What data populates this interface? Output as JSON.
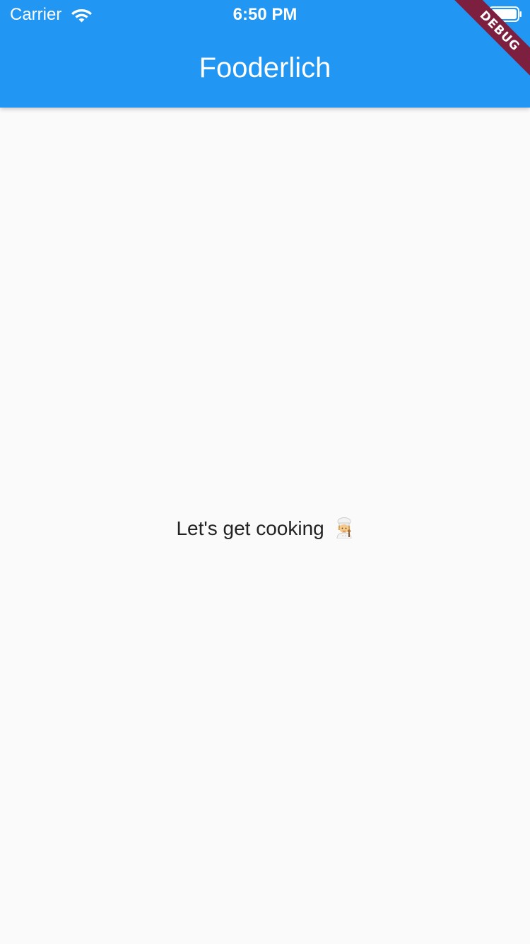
{
  "status_bar": {
    "carrier": "Carrier",
    "time": "6:50 PM",
    "wifi_icon": "wifi-icon",
    "battery_icon": "battery-icon"
  },
  "app_bar": {
    "title": "Fooderlich",
    "color": "#2196f3"
  },
  "debug_banner": {
    "label": "DEBUG",
    "color": "#7d1f3e"
  },
  "body": {
    "message": "Let's get cooking",
    "emoji_icon": "cook-emoji-icon",
    "background": "#fafafa"
  }
}
